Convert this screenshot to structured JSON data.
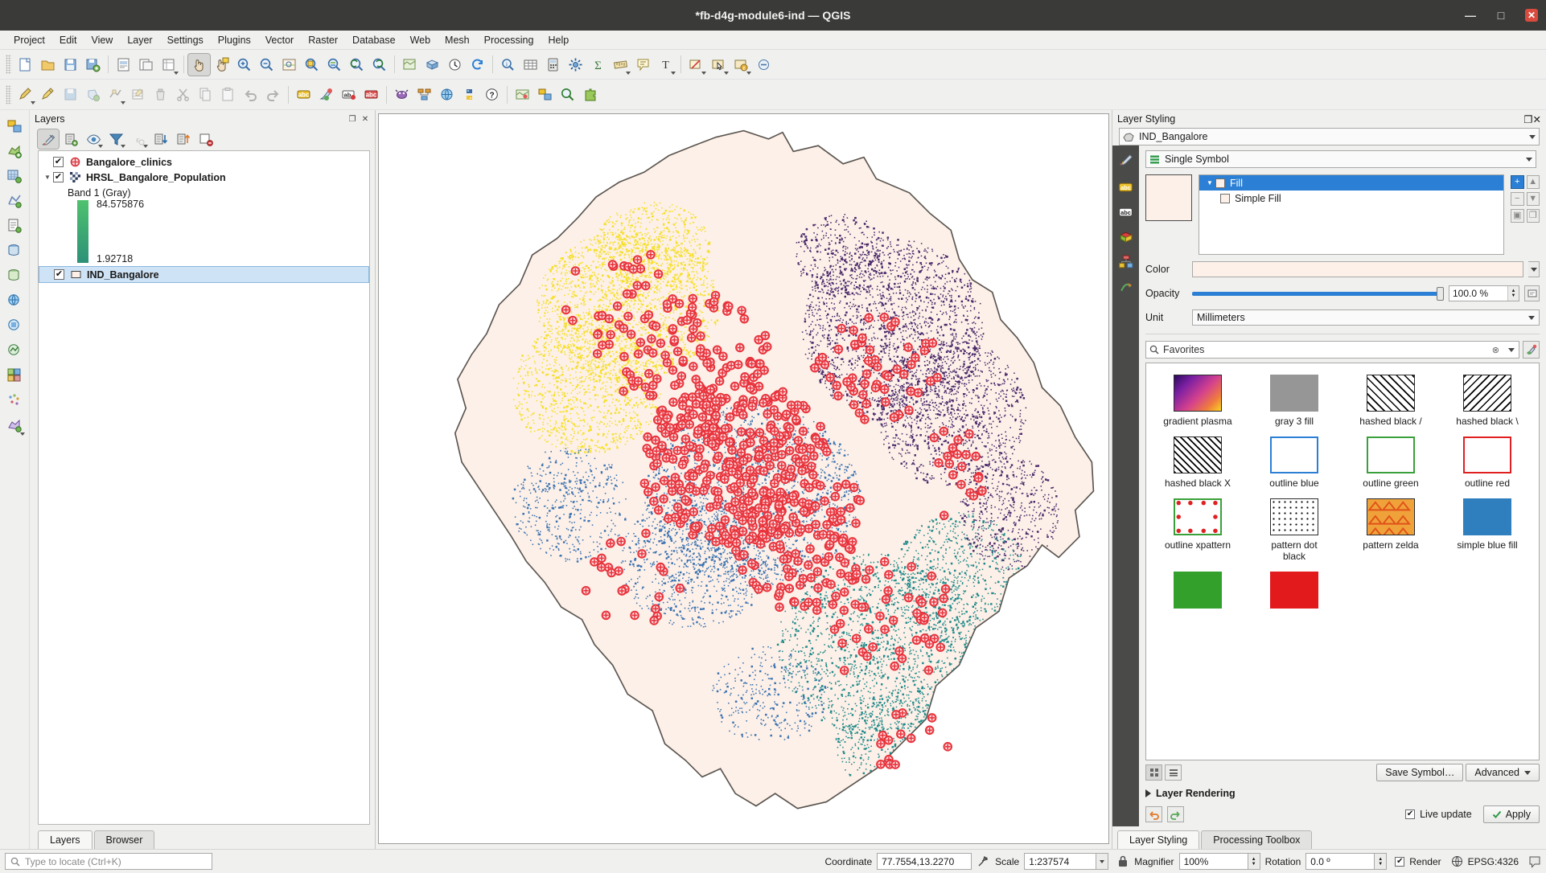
{
  "window": {
    "title": "*fb-d4g-module6-ind — QGIS",
    "buttons": {
      "minimize": "—",
      "maximize": "□",
      "close": "✕"
    }
  },
  "menubar": {
    "items": [
      "Project",
      "Edit",
      "View",
      "Layer",
      "Settings",
      "Plugins",
      "Vector",
      "Raster",
      "Database",
      "Web",
      "Mesh",
      "Processing",
      "Help"
    ]
  },
  "layers_panel": {
    "title": "Layers",
    "toolbar_icons": [
      "open-layer-styling-panel-icon",
      "add-group-icon",
      "manage-visibility-icon",
      "filter-legend-icon",
      "filter-legend-expression-icon",
      "expand-all-icon",
      "collapse-all-icon",
      "remove-layer-icon"
    ],
    "items": [
      {
        "name": "Bangalore_clinics",
        "checked": "✔",
        "icon": "point-layer-icon",
        "expandable": false,
        "selected": false
      },
      {
        "name": "HRSL_Bangalore_Population",
        "checked": "✔",
        "icon": "raster-layer-icon",
        "expandable": true,
        "selected": false
      },
      {
        "name": "IND_Bangalore",
        "checked": "✔",
        "icon": "polygon-layer-icon",
        "expandable": false,
        "selected": true
      }
    ],
    "raster_band": "Band 1 (Gray)",
    "raster_max": "84.575876",
    "raster_min": "1.92718",
    "ramp_top_color": "#4fc26e",
    "ramp_bottom_color": "#2c9178",
    "tabs": [
      {
        "label": "Layers",
        "active": true
      },
      {
        "label": "Browser",
        "active": false
      }
    ]
  },
  "style_panel": {
    "title": "Layer Styling",
    "layer_combo": "IND_Bangalore",
    "renderer_combo": "Single Symbol",
    "symbol_tree": [
      {
        "label": "Fill",
        "level": 0,
        "selected": true,
        "expander": "▾"
      },
      {
        "label": "Simple Fill",
        "level": 1,
        "selected": false,
        "expander": ""
      }
    ],
    "fill_color": "#fdf0e8",
    "properties": {
      "color_label": "Color",
      "color_value": "#fdf0e8",
      "opacity_label": "Opacity",
      "opacity_value": "100.0 %",
      "unit_label": "Unit",
      "unit_value": "Millimeters"
    },
    "search_placeholder": "Favorites",
    "symbols": [
      {
        "label": "gradient plasma",
        "kind": "gradient-plasma"
      },
      {
        "label": "gray 3 fill",
        "kind": "gray-fill"
      },
      {
        "label": "hashed black /",
        "kind": "hatch-forward"
      },
      {
        "label": "hashed black \\",
        "kind": "hatch-back"
      },
      {
        "label": "hashed black X",
        "kind": "hatch-cross"
      },
      {
        "label": "outline blue",
        "kind": "outline-blue"
      },
      {
        "label": "outline green",
        "kind": "outline-green"
      },
      {
        "label": "outline red",
        "kind": "outline-red"
      },
      {
        "label": "outline xpattern",
        "kind": "outline-xpattern"
      },
      {
        "label": "pattern dot black",
        "kind": "pattern-dot"
      },
      {
        "label": "pattern zelda",
        "kind": "pattern-zelda"
      },
      {
        "label": "simple blue fill",
        "kind": "simple-blue"
      },
      {
        "label": "",
        "kind": "simple-green"
      },
      {
        "label": "",
        "kind": "simple-red"
      }
    ],
    "save_symbol_label": "Save Symbol…",
    "advanced_label": "Advanced",
    "layer_rendering_label": "Layer Rendering",
    "live_update_label": "Live update",
    "live_update_checked": "✔",
    "apply_label": "Apply",
    "tabs": [
      {
        "label": "Layer Styling",
        "active": true
      },
      {
        "label": "Processing Toolbox",
        "active": false
      }
    ]
  },
  "statusbar": {
    "locator_placeholder": "Type to locate (Ctrl+K)",
    "coordinate_label": "Coordinate",
    "coordinate_value": "77.7554,13.2270",
    "scale_label": "Scale",
    "scale_value": "1:237574",
    "magnifier_label": "Magnifier",
    "magnifier_value": "100%",
    "rotation_label": "Rotation",
    "rotation_value": "0.0 º",
    "render_label": "Render",
    "render_checked": "✔",
    "crs_label": "EPSG:4326"
  },
  "map": {
    "boundary_fill": "#fdf0e8",
    "boundary_stroke": "#5a554f",
    "clinic_color": "#e8333c",
    "pop_colors": [
      "#f5e02a",
      "#4a2a6b",
      "#3a72b0",
      "#1f8a8a"
    ]
  }
}
